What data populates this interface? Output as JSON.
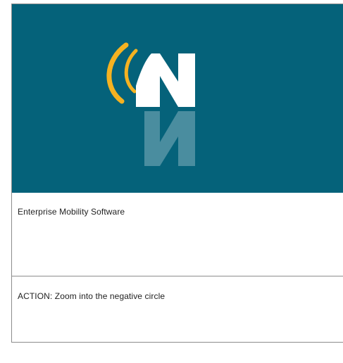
{
  "slide": {
    "brand_color": "#05627a",
    "accent_color": "#f5b221",
    "logo_icon": "wireless-n-logo-icon",
    "caption": "Enterprise Mobility Software",
    "action": "ACTION: Zoom into the negative circle"
  }
}
